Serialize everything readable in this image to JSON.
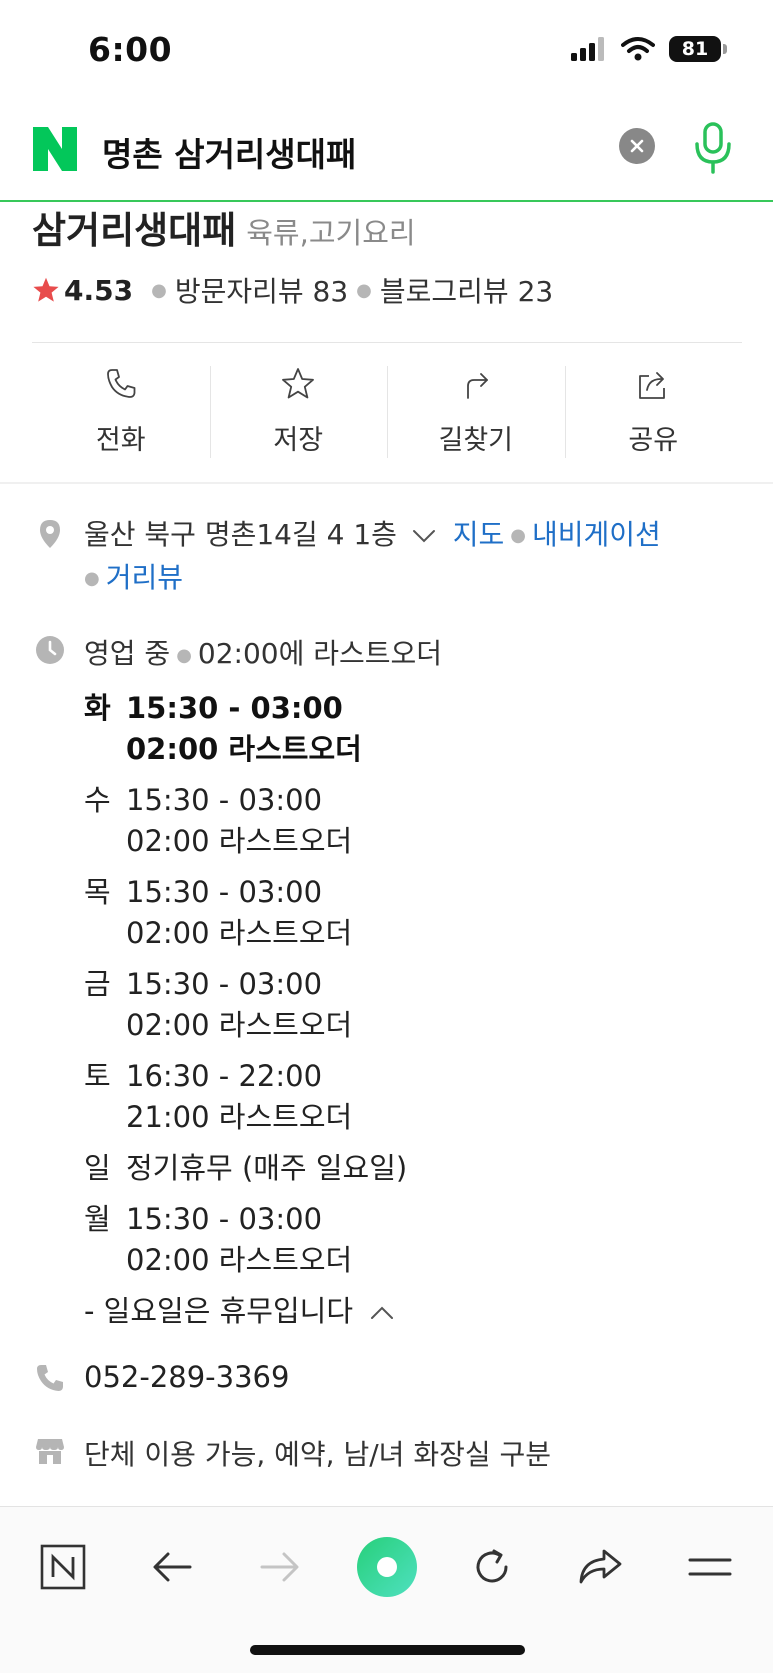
{
  "status_bar": {
    "time": "6:00",
    "battery": "81"
  },
  "search": {
    "query": "명촌 삼거리생대패"
  },
  "place": {
    "name": "삼거리생대패",
    "category": "육류,고기요리",
    "rating": "4.53",
    "visitor_reviews": "방문자리뷰 83",
    "blog_reviews": "블로그리뷰 23"
  },
  "actions": [
    {
      "label": "전화",
      "icon": "phone-icon"
    },
    {
      "label": "저장",
      "icon": "star-icon"
    },
    {
      "label": "길찾기",
      "icon": "directions-icon"
    },
    {
      "label": "공유",
      "icon": "share-icon"
    }
  ],
  "address": {
    "text": "울산 북구 명촌14길 4 1층",
    "map_link": "지도",
    "navigation_link": "내비게이션",
    "street_view_link": "거리뷰"
  },
  "business": {
    "status": "영업 중",
    "last_order": "02:00에 라스트오더",
    "hours": [
      {
        "day": "화",
        "time": "15:30 - 03:00",
        "last": "02:00 라스트오더",
        "today": true
      },
      {
        "day": "수",
        "time": "15:30 - 03:00",
        "last": "02:00 라스트오더"
      },
      {
        "day": "목",
        "time": "15:30 - 03:00",
        "last": "02:00 라스트오더"
      },
      {
        "day": "금",
        "time": "15:30 - 03:00",
        "last": "02:00 라스트오더"
      },
      {
        "day": "토",
        "time": "16:30 - 22:00",
        "last": "21:00 라스트오더"
      },
      {
        "day": "일",
        "time": "정기휴무 (매주 일요일)",
        "last": ""
      },
      {
        "day": "월",
        "time": "15:30 - 03:00",
        "last": "02:00 라스트오더"
      }
    ],
    "note": "- 일요일은 휴무입니다"
  },
  "phone": "052-289-3369",
  "facilities": "단체 이용 가능, 예약, 남/녀 화장실 구분",
  "colors": {
    "naver_green": "#03c75a",
    "link_blue": "#1f6fc7",
    "star_red": "#e84c4c"
  }
}
